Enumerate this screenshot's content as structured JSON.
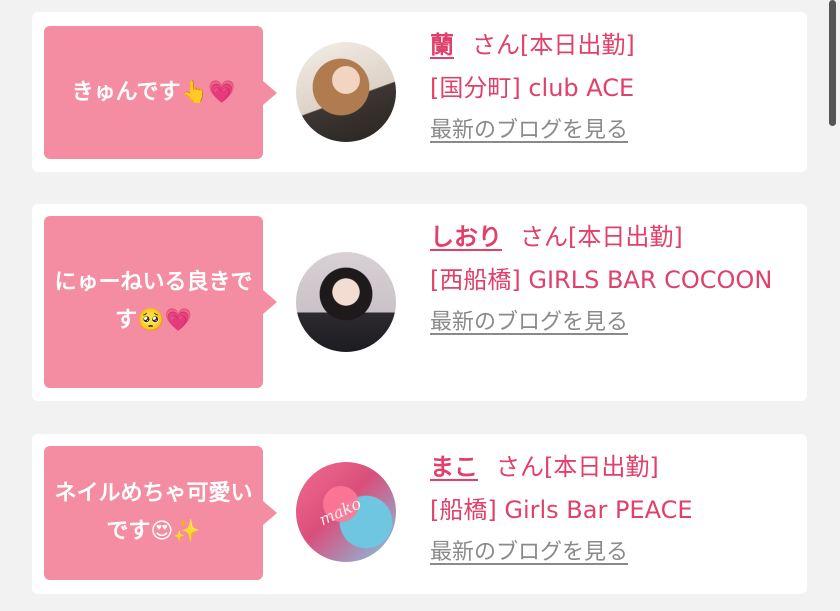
{
  "cards": [
    {
      "comment": "きゅんです👆💗",
      "name": "蘭",
      "status": "さん[本日出勤]",
      "shop": "[国分町] club ACE",
      "blog_link": "最新のブログを見る"
    },
    {
      "comment": "にゅーねいる良きです🥺💗",
      "name": "しおり",
      "status": "さん[本日出勤]",
      "shop": "[西船橋] GIRLS BAR COCOON",
      "blog_link": "最新のブログを見る"
    },
    {
      "comment": "ネイルめちゃ可愛いです😍✨",
      "name": "まこ",
      "status": "さん[本日出勤]",
      "shop": "[船橋] Girls Bar PEACE",
      "blog_link": "最新のブログを見る",
      "photo_watermark": "mako"
    }
  ],
  "colors": {
    "bubble": "#f48da1",
    "accent_text": "#e0406a",
    "link_gray": "#8a8a8a",
    "background": "#f2f2f2"
  }
}
